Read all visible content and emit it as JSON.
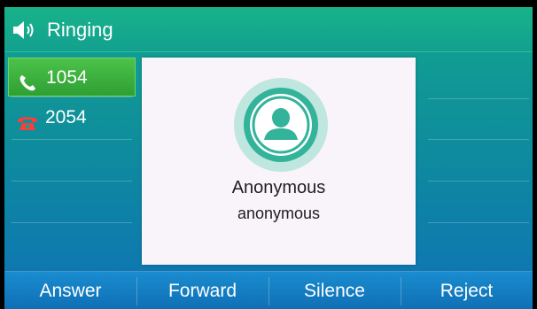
{
  "header": {
    "title": "Ringing",
    "icon": "speaker-volume-icon"
  },
  "lines": [
    {
      "label": "1054",
      "icon": "phone-handset-icon",
      "active": true
    },
    {
      "label": "2054",
      "icon": "desk-phone-icon",
      "active": false
    }
  ],
  "caller": {
    "name": "Anonymous",
    "number": "anonymous",
    "avatar_icon": "user-avatar-icon"
  },
  "softkeys": [
    {
      "label": "Answer"
    },
    {
      "label": "Forward"
    },
    {
      "label": "Silence"
    },
    {
      "label": "Reject"
    }
  ],
  "colors": {
    "active_line": "#3fb23f",
    "avatar_ring": "#32b39a",
    "softkey_bar": "#1580c4"
  }
}
